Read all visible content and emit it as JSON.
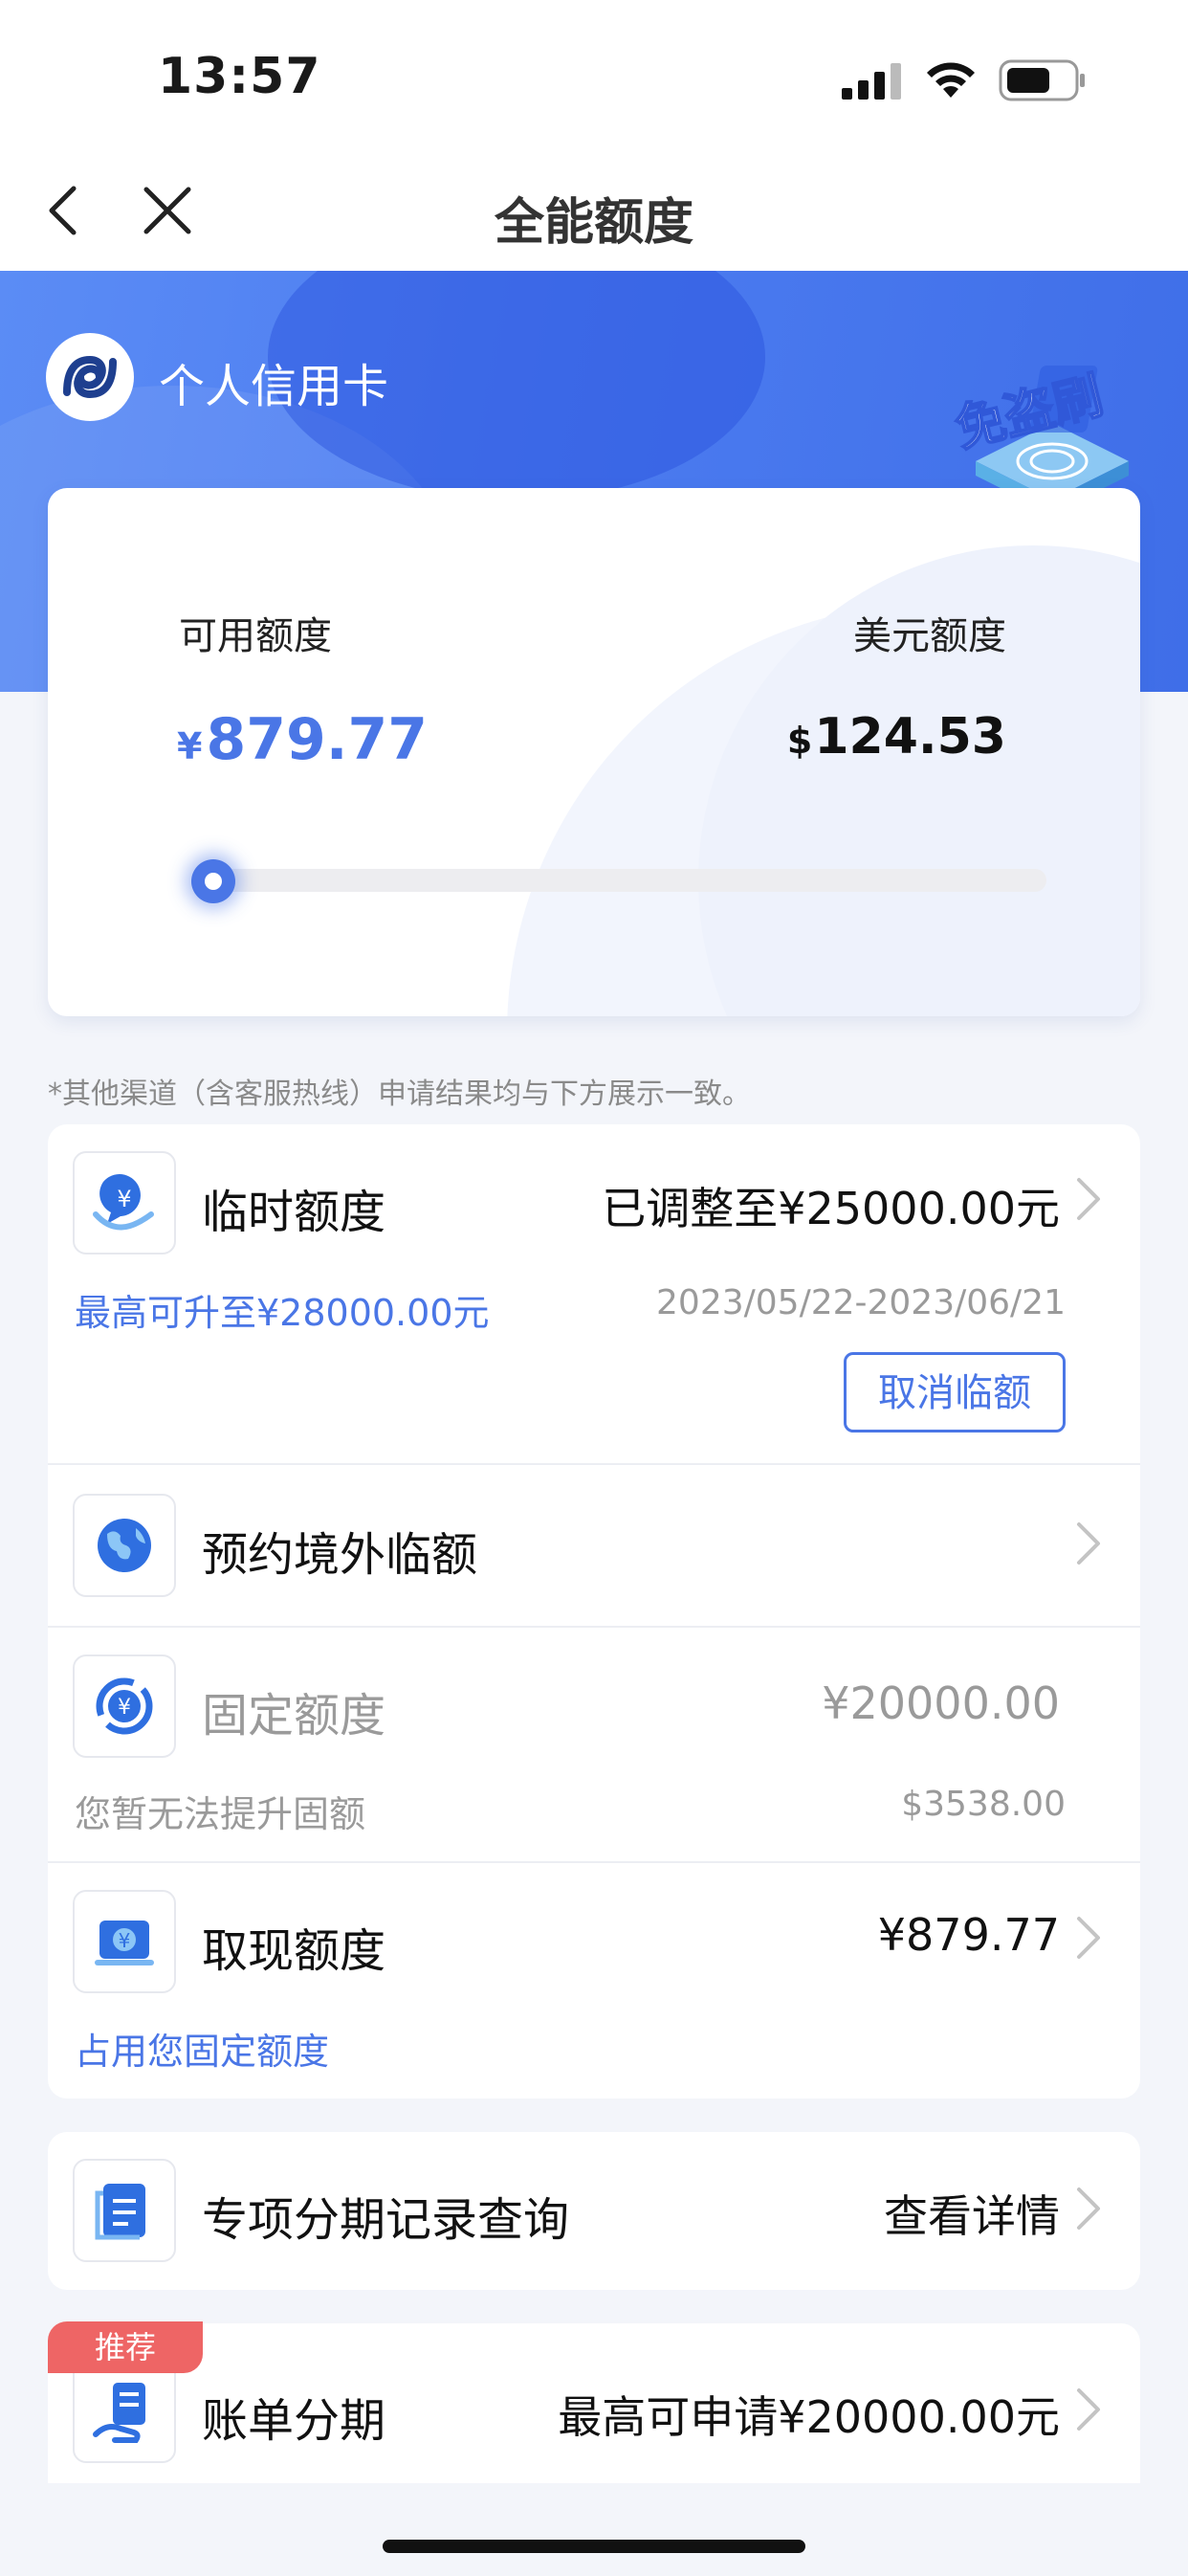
{
  "status_bar": {
    "time": "13:57"
  },
  "nav": {
    "title": "全能额度"
  },
  "hero": {
    "brand": "个人信用卡",
    "badge_text": "免盗刷"
  },
  "quota_card": {
    "available_label": "可用额度",
    "usd_label": "美元额度",
    "cny_symbol": "¥",
    "cny_amount": "879.77",
    "usd_symbol": "$",
    "usd_amount": "124.53",
    "usage_fraction": 0.0
  },
  "notice": "*其他渠道（含客服热线）申请结果均与下方展示一致。",
  "rows": {
    "temp": {
      "title": "临时额度",
      "value": "已调整至¥25000.00元",
      "sub_left": "最高可升至¥28000.00元",
      "sub_right": "2023/05/22-2023/06/21",
      "button": "取消临额"
    },
    "overseas": {
      "title": "预约境外临额"
    },
    "fixed": {
      "title": "固定额度",
      "value": "¥20000.00",
      "sub_left": "您暂无法提升固额",
      "sub_right": "$3538.00"
    },
    "cash": {
      "title": "取现额度",
      "value": "¥879.77",
      "sub_left": "占用您固定额度"
    },
    "installment_records": {
      "title": "专项分期记录查询",
      "value": "查看详情"
    },
    "bill_installment": {
      "tag": "推荐",
      "title": "账单分期",
      "value": "最高可申请¥20000.00元"
    }
  },
  "colors": {
    "accent": "#4a76e6",
    "hero": "#4c7cf0",
    "tag": "#ee6565"
  }
}
